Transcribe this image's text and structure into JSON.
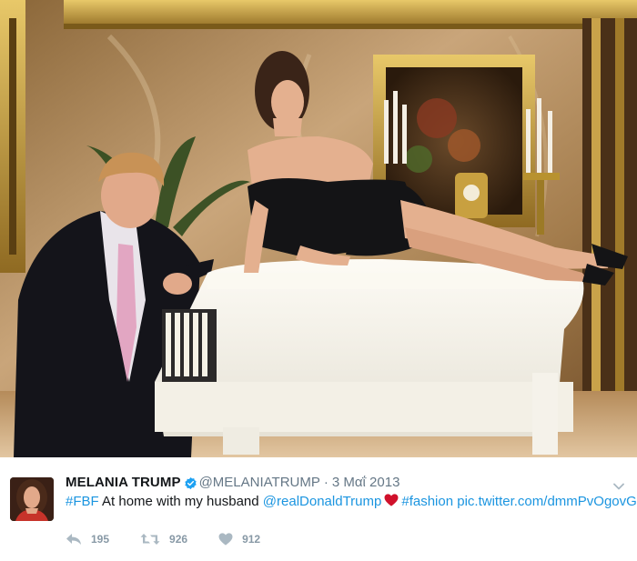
{
  "tweet": {
    "display_name": "MELANIA TRUMP",
    "handle": "@MELANIATRUMP",
    "separator": "·",
    "date": "3 Μαΐ 2013",
    "text_parts": {
      "hashtag_fbf": "#FBF",
      "plain": " At home with my husband ",
      "mention": "@realDonaldTrump",
      "hashtag_fashion": "#fashion",
      "pic_link": "pic.twitter.com/dmmPvOgovG"
    },
    "actions": {
      "reply_count": "195",
      "retweet_count": "926",
      "like_count": "912"
    }
  },
  "icons": {
    "verified": "verified-badge-icon",
    "heart_emoji": "red-heart-icon",
    "caret": "chevron-down-icon",
    "reply": "reply-icon",
    "retweet": "retweet-icon",
    "like": "heart-icon"
  },
  "colors": {
    "link": "#1b95e0",
    "text": "#14171a",
    "muted": "#657786",
    "action_gray": "#8899a6",
    "heart_red": "#d0112b"
  }
}
